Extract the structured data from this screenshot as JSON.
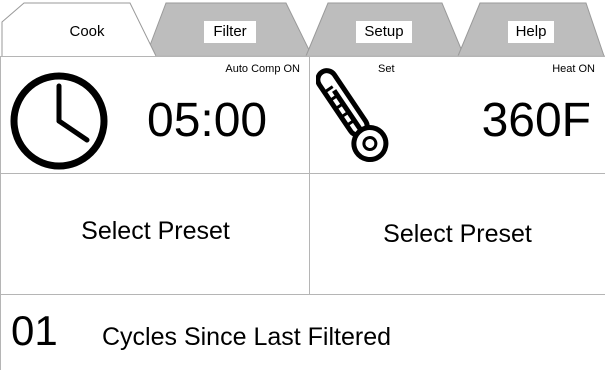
{
  "tabs": [
    {
      "label": "Cook",
      "active": true
    },
    {
      "label": "Filter",
      "active": false
    },
    {
      "label": "Setup",
      "active": false
    },
    {
      "label": "Help",
      "active": false
    }
  ],
  "timer": {
    "status": "Auto Comp ON",
    "value": "05:00",
    "icon": "clock-icon"
  },
  "temperature": {
    "status_left": "Set",
    "status_right": "Heat ON",
    "value": "360F",
    "icon": "thermometer-icon"
  },
  "presets": {
    "left": "Select Preset",
    "right": "Select Preset"
  },
  "cycles": {
    "count": "01",
    "label": "Cycles Since Last Filtered"
  },
  "colors": {
    "inactive_tab": "#bdbdbd",
    "border": "#b5b5b5",
    "text": "#000000",
    "background": "#ffffff"
  }
}
